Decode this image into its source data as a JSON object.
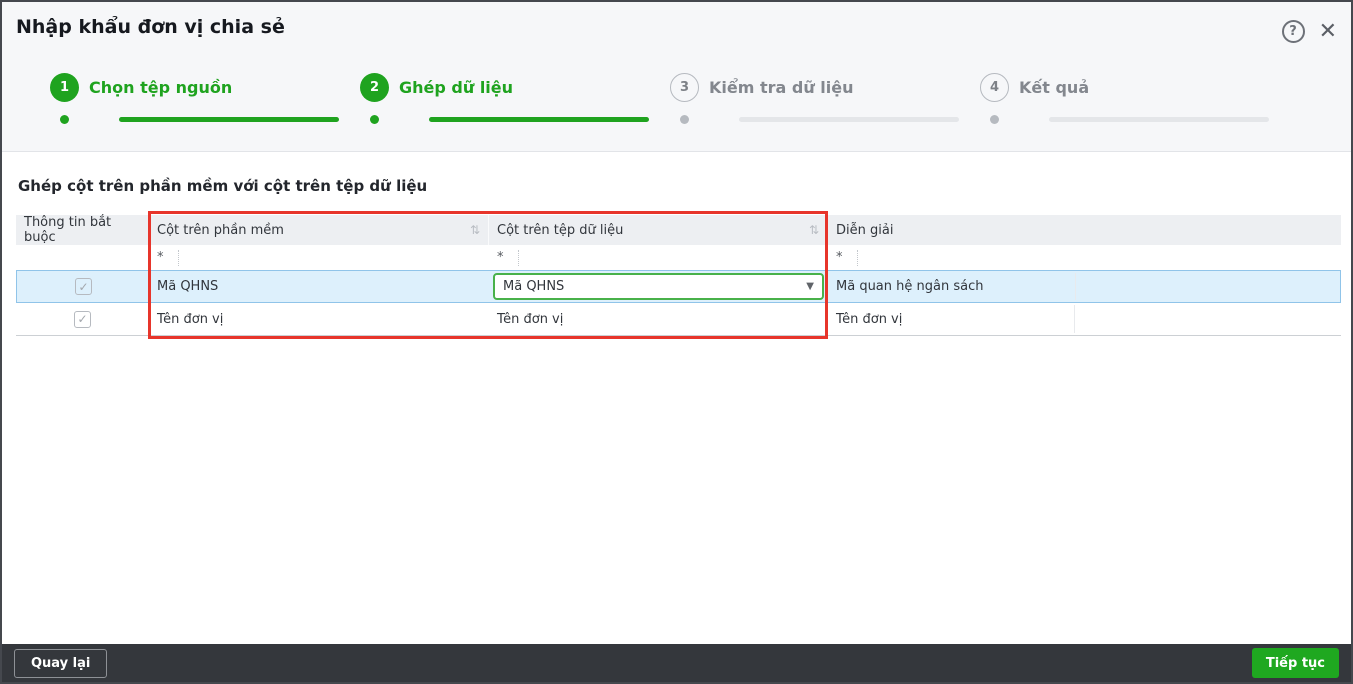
{
  "dialog": {
    "title": "Nhập khẩu đơn vị chia sẻ"
  },
  "icons": {
    "help": "?",
    "close": "✕",
    "sort": "⇅",
    "dropdown_arrow": "▼",
    "check": "✓"
  },
  "stepper": {
    "steps": [
      {
        "number": "1",
        "label": "Chọn tệp nguồn",
        "state": "done"
      },
      {
        "number": "2",
        "label": "Ghép dữ liệu",
        "state": "done"
      },
      {
        "number": "3",
        "label": "Kiểm tra dữ liệu",
        "state": "pending"
      },
      {
        "number": "4",
        "label": "Kết quả",
        "state": "pending"
      }
    ]
  },
  "section": {
    "title": "Ghép cột trên phần mềm với cột trên tệp dữ liệu"
  },
  "table": {
    "columns": [
      "Thông tin bắt buộc",
      "Cột trên phần mềm",
      "Cột trên tệp dữ liệu",
      "Diễn giải"
    ],
    "filter_all": "*",
    "rows": [
      {
        "required": true,
        "software_column": "Mã QHNS",
        "file_column": "Mã QHNS",
        "description": "Mã quan hệ ngân sách",
        "selected": true
      },
      {
        "required": true,
        "software_column": "Tên đơn vị",
        "file_column": "Tên đơn vị",
        "description": "Tên đơn vị",
        "selected": false
      }
    ]
  },
  "footer": {
    "back_label": "Quay lại",
    "continue_label": "Tiếp tục"
  },
  "colors": {
    "accent_green": "#1fa31f",
    "button_green": "#1fa820",
    "select_border_green": "#48b14a",
    "selected_row_bg": "#ddf0fc",
    "selected_row_border": "#90c4e9",
    "highlight_red": "#e7352b",
    "footer_bg": "#34373c"
  }
}
